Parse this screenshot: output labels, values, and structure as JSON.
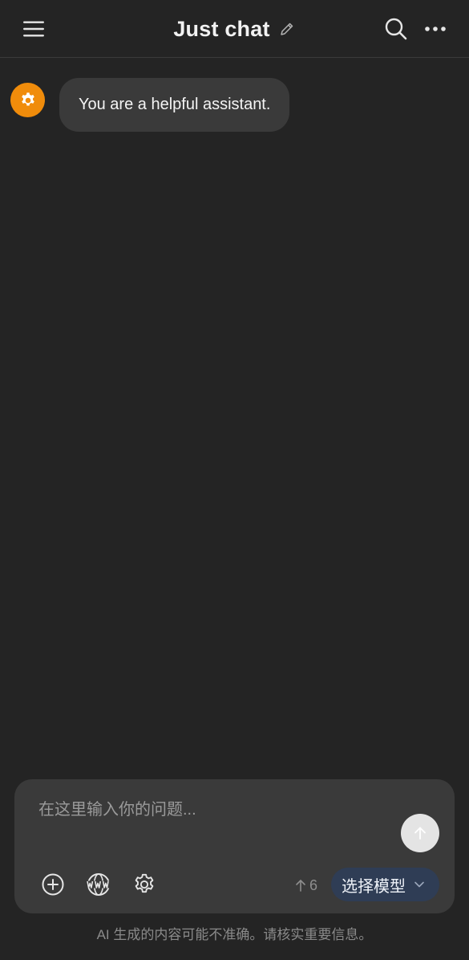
{
  "header": {
    "title": "Just chat",
    "menu_icon": "hamburger-menu-icon",
    "edit_icon": "pencil-icon",
    "search_icon": "search-icon",
    "more_icon": "more-horizontal-icon"
  },
  "messages": [
    {
      "role": "system",
      "avatar_icon": "gear-icon",
      "avatar_color": "#f08c0b",
      "text": "You are a helpful assistant."
    }
  ],
  "composer": {
    "placeholder": "在这里输入你的问题...",
    "value": "",
    "send_icon": "arrow-up-icon",
    "tools": [
      {
        "name": "attach",
        "icon": "plus-circle-icon"
      },
      {
        "name": "web",
        "icon": "www-globe-icon"
      },
      {
        "name": "settings",
        "icon": "gear-icon"
      }
    ],
    "token_count": "6",
    "token_icon": "arrow-up-icon",
    "model_label": "选择模型",
    "model_icon": "chevron-down-icon"
  },
  "footer": {
    "disclaimer": "AI 生成的内容可能不准确。请核实重要信息。"
  },
  "colors": {
    "background": "#242424",
    "surface": "#3a3a3a",
    "accent_avatar": "#f08c0b",
    "model_button": "#2f3d55"
  }
}
